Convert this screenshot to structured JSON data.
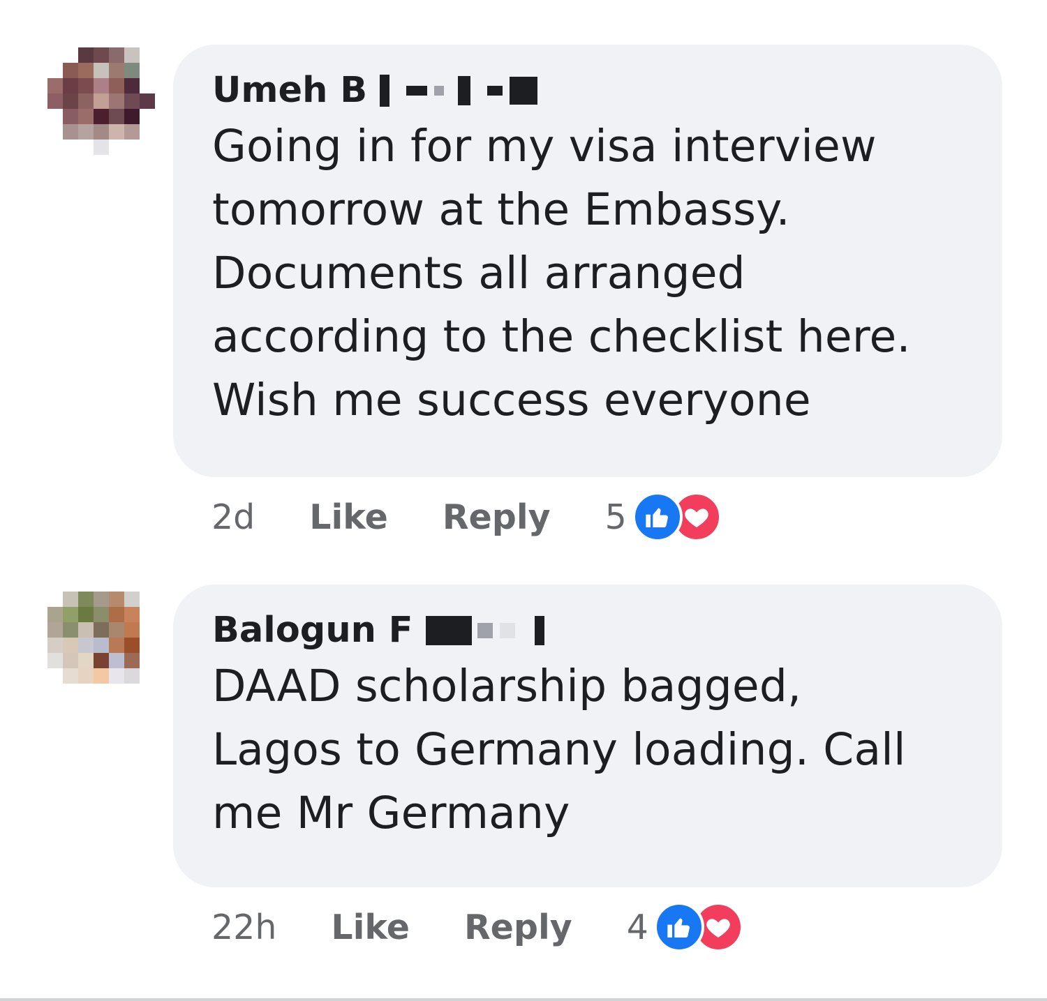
{
  "comments": [
    {
      "author": "Umeh B",
      "text_lines": [
        "Going in for my visa interview",
        "tomorrow at the Embassy.",
        "Documents all arranged",
        "according to the checklist here.",
        "Wish me success everyone"
      ],
      "time": "2d",
      "like_label": "Like",
      "reply_label": "Reply",
      "reaction_count": "5",
      "reactions": [
        "like-icon",
        "love-icon"
      ]
    },
    {
      "author": "Balogun F",
      "text_lines": [
        "DAAD scholarship bagged,",
        "Lagos to Germany loading. Call",
        "me Mr Germany"
      ],
      "time": "22h",
      "like_label": "Like",
      "reply_label": "Reply",
      "reaction_count": "4",
      "reactions": [
        "like-icon",
        "love-icon"
      ]
    }
  ],
  "colors": {
    "bubble": "#f0f2f5",
    "text": "#1c1e21",
    "meta": "#65676b",
    "like_reaction": "#1877f2",
    "love_reaction": "#f23e5c"
  }
}
